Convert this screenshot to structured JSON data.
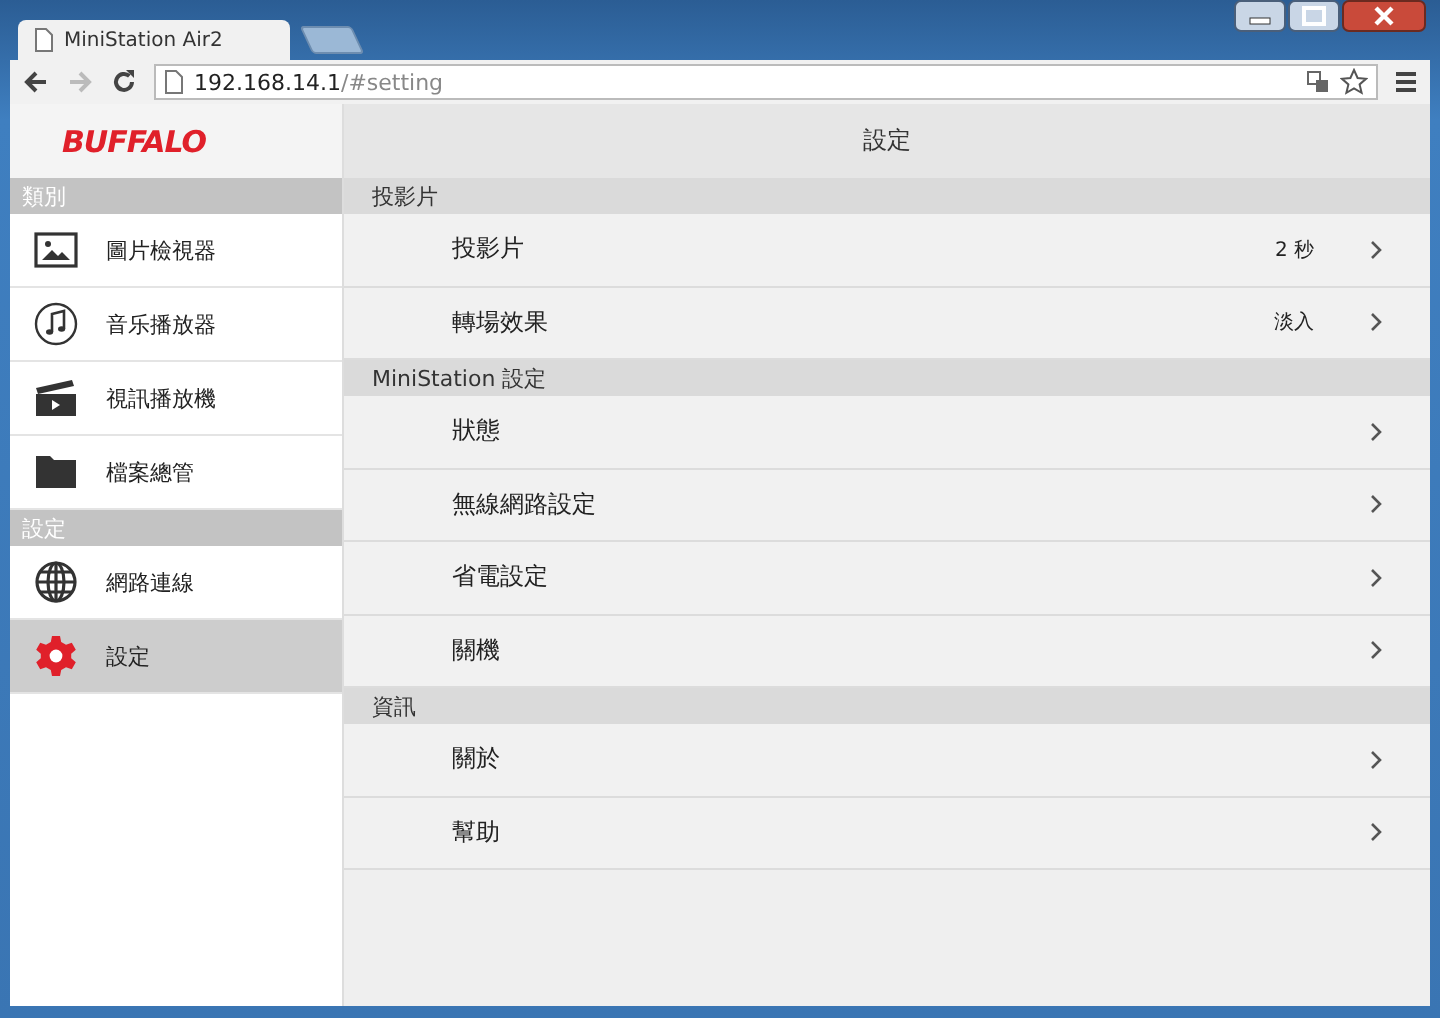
{
  "browser": {
    "tab_title": "MiniStation Air2",
    "address_host": "192.168.14.1",
    "address_path": "/#setting"
  },
  "sidebar": {
    "logo": "BUFFALO",
    "sections": [
      {
        "title": "類別",
        "items": [
          {
            "label": "圖片檢視器",
            "kind": "image",
            "selected": false
          },
          {
            "label": "音乐播放器",
            "kind": "music",
            "selected": false
          },
          {
            "label": "視訊播放機",
            "kind": "video",
            "selected": false
          },
          {
            "label": "檔案總管",
            "kind": "folder",
            "selected": false
          }
        ]
      },
      {
        "title": "設定",
        "items": [
          {
            "label": "網路連線",
            "kind": "globe",
            "selected": false
          },
          {
            "label": "設定",
            "kind": "gear",
            "selected": true
          }
        ]
      }
    ]
  },
  "content": {
    "title": "設定",
    "sections": [
      {
        "title": "投影片",
        "rows": [
          {
            "label": "投影片",
            "value": "2 秒"
          },
          {
            "label": "轉場效果",
            "value": "淡入"
          }
        ]
      },
      {
        "title": "MiniStation 設定",
        "rows": [
          {
            "label": "狀態"
          },
          {
            "label": "無線網路設定"
          },
          {
            "label": "省電設定"
          },
          {
            "label": "關機"
          }
        ]
      },
      {
        "title": "資訊",
        "rows": [
          {
            "label": "關於"
          },
          {
            "label": "幫助"
          }
        ]
      }
    ]
  }
}
